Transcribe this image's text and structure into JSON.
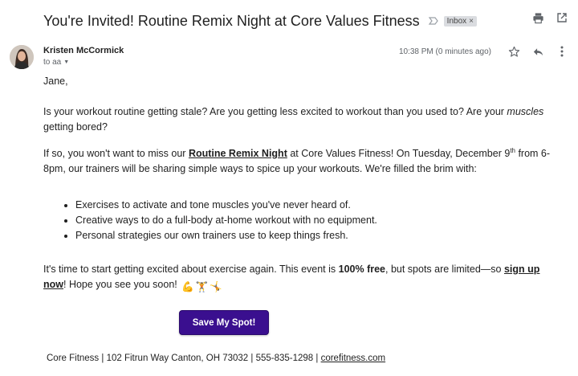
{
  "email": {
    "subject": "You're Invited! Routine Remix Night at Core Values Fitness",
    "label": "Inbox",
    "label_remove": "×",
    "sender_name": "Kristen McCormick",
    "to_line": "to aa",
    "timestamp": "10:38 PM (0 minutes ago)"
  },
  "body": {
    "greeting": "Jane,",
    "p1_a": "Is your workout routine getting stale? Are you getting less excited to workout than you used to? Are your ",
    "p1_em": "muscles",
    "p1_b": " getting bored?",
    "p2_a": "If so, you won't want to miss our ",
    "p2_link": "Routine Remix Night",
    "p2_b": " at Core Values Fitness! On Tuesday, December 9",
    "p2_sup": "th",
    "p2_c": " from 6-8pm, our trainers will be sharing simple ways to spice up your workouts. We're filled the brim with:",
    "bullets": [
      "Exercises to activate and tone muscles you've never heard of.",
      "Creative ways to do a full-body at-home workout with no equipment.",
      "Personal strategies our own trainers use to keep things fresh."
    ],
    "p3_a": "It's time to start getting excited about exercise again. This event is ",
    "p3_bold": "100% free",
    "p3_b": ", but spots are limited—so ",
    "p3_link": "sign up now",
    "p3_c": "! Hope you see you soon! ",
    "emojis": [
      "💪",
      "🏋",
      "🤸"
    ]
  },
  "cta": {
    "label": "Save My Spot!"
  },
  "footer": {
    "text": "Core Fitness | 102 Fitrun Way Canton, OH 73032 | 555-835-1298 | ",
    "link": "corefitness.com"
  },
  "icons": {
    "label_arrow": "label-arrow-icon",
    "print": "print-icon",
    "open_new": "open-in-new-icon",
    "star": "star-icon",
    "reply": "reply-icon",
    "more": "more-vert-icon"
  },
  "colors": {
    "cta_bg": "#3a0f8f",
    "badge_bg": "#dadce0",
    "muted": "#5f6368"
  }
}
